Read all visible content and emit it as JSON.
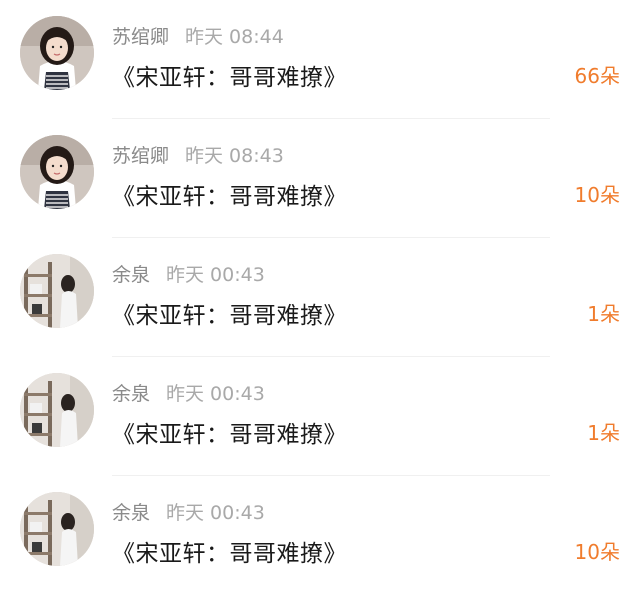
{
  "comments": [
    {
      "user": "苏绾卿",
      "time": "昨天 08:44",
      "book_title": "《宋亚轩：哥哥难撩》",
      "flowers": "66朵",
      "avatar": "girl-portrait-avatar"
    },
    {
      "user": "苏绾卿",
      "time": "昨天 08:43",
      "book_title": "《宋亚轩：哥哥难撩》",
      "flowers": "10朵",
      "avatar": "girl-portrait-avatar"
    },
    {
      "user": "余泉",
      "time": "昨天 00:43",
      "book_title": "《宋亚轩：哥哥难撩》",
      "flowers": "1朵",
      "avatar": "room-scene-avatar"
    },
    {
      "user": "余泉",
      "time": "昨天 00:43",
      "book_title": "《宋亚轩：哥哥难撩》",
      "flowers": "1朵",
      "avatar": "room-scene-avatar"
    },
    {
      "user": "余泉",
      "time": "昨天 00:43",
      "book_title": "《宋亚轩：哥哥难撩》",
      "flowers": "10朵",
      "avatar": "room-scene-avatar"
    }
  ],
  "colors": {
    "count_accent": "#f07c2d",
    "username": "#8a8a8a",
    "timestamp": "#a9a9a9",
    "title": "#1a1a1a"
  }
}
